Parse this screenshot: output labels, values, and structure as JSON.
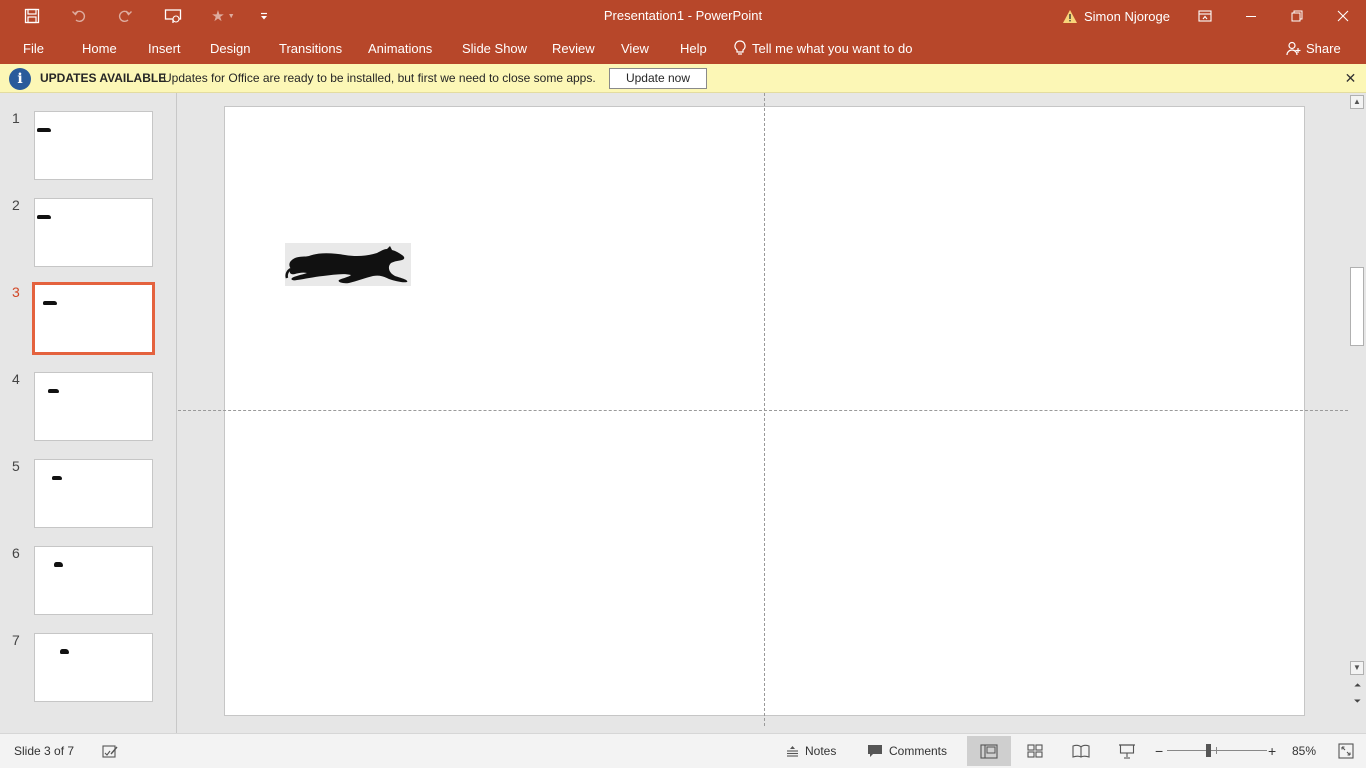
{
  "titlebar": {
    "title": "Presentation1  -  PowerPoint",
    "user": "Simon Njoroge",
    "icons": [
      "save-icon",
      "undo-icon",
      "redo-icon",
      "present-from-beginning-icon",
      "star-icon",
      "customize-qat-icon",
      "warning-icon",
      "ribbon-display-icon",
      "minimize-icon",
      "restore-icon",
      "close-icon"
    ]
  },
  "ribbon": {
    "tabs": [
      "File",
      "Home",
      "Insert",
      "Design",
      "Transitions",
      "Animations",
      "Slide Show",
      "Review",
      "View",
      "Help"
    ],
    "tell_me": "Tell me what you want to do",
    "share": "Share"
  },
  "update_bar": {
    "title": "UPDATES AVAILABLE",
    "message": "Updates for Office are ready to be installed, but first we need to close some apps.",
    "button": "Update now"
  },
  "thumbnails": {
    "numbers": [
      "1",
      "2",
      "3",
      "4",
      "5",
      "6",
      "7"
    ],
    "active_index": 3
  },
  "status": {
    "slide_info": "Slide 3 of 7",
    "notes": "Notes",
    "comments": "Comments",
    "zoom": "85%",
    "zoom_minus": "−",
    "zoom_plus": "+"
  },
  "colors": {
    "accent": "#b7472a",
    "update_bar": "#fcf7b6",
    "active_thumb": "#e4623e"
  }
}
